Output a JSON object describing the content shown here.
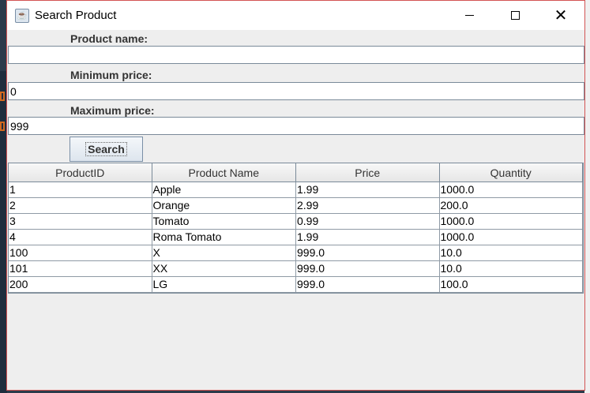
{
  "window": {
    "title": "Search Product",
    "icon": "java-cup-icon"
  },
  "form": {
    "product_name_label": "Product name:",
    "product_name_value": "",
    "min_price_label": "Minimum price:",
    "min_price_value": "0",
    "max_price_label": "Maximum price:",
    "max_price_value": "999",
    "search_label": "Search"
  },
  "table": {
    "headers": [
      "ProductID",
      "Product Name",
      "Price",
      "Quantity"
    ],
    "rows": [
      [
        "1",
        "Apple",
        "1.99",
        "1000.0"
      ],
      [
        "2",
        "Orange",
        "2.99",
        "200.0"
      ],
      [
        "3",
        "Tomato",
        "0.99",
        "1000.0"
      ],
      [
        "4",
        "Roma Tomato",
        "1.99",
        "1000.0"
      ],
      [
        "100",
        "X",
        "999.0",
        "10.0"
      ],
      [
        "101",
        "XX",
        "999.0",
        "10.0"
      ],
      [
        "200",
        "LG",
        "999.0",
        "100.0"
      ]
    ]
  }
}
